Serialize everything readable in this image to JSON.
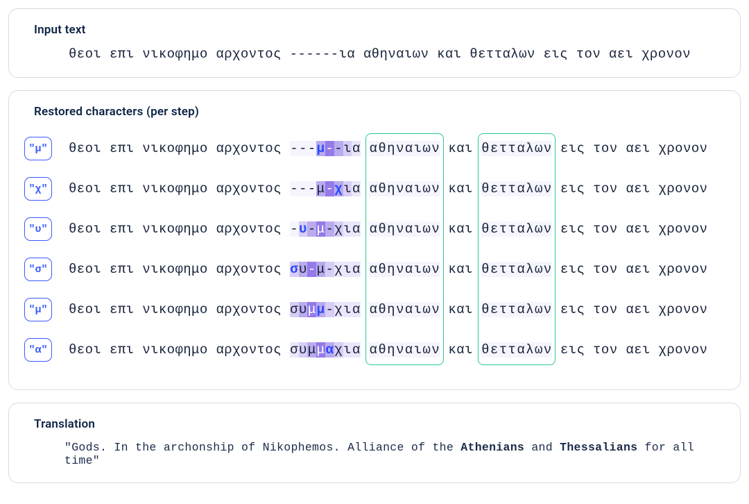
{
  "input_panel": {
    "title": "Input text",
    "text": "θεοι επι νικοφημο αρχοντος ------ια αθηναιων και θετταλων εις τον αει χρονον"
  },
  "steps_panel": {
    "title": "Restored characters (per step)",
    "highlight_words": [
      "αθηναιων",
      "θετταλων"
    ],
    "steps": [
      {
        "badge": "\"μ\"",
        "tokens": [
          "θεοι",
          "επι",
          "νικοφημο",
          "αρχοντος",
          {
            "chars": [
              {
                "c": "-",
                "s": 0
              },
              {
                "c": "-",
                "s": 0
              },
              {
                "c": "-",
                "s": 0
              },
              {
                "c": "μ",
                "s": 3,
                "new": true
              },
              {
                "c": "-",
                "s": 4
              },
              {
                "c": "-",
                "s": 3
              },
              {
                "c": "ι",
                "s": 2
              },
              {
                "c": "α",
                "s": 1
              }
            ]
          },
          "αθηναιων",
          "και",
          "θετταλων",
          "εις",
          "τον",
          "αει",
          "χρονον"
        ]
      },
      {
        "badge": "\"χ\"",
        "tokens": [
          "θεοι",
          "επι",
          "νικοφημο",
          "αρχοντος",
          {
            "chars": [
              {
                "c": "-",
                "s": 0
              },
              {
                "c": "-",
                "s": 0
              },
              {
                "c": "-",
                "s": 0
              },
              {
                "c": "μ",
                "s": 3
              },
              {
                "c": "-",
                "s": 4
              },
              {
                "c": "χ",
                "s": 3,
                "new": true
              },
              {
                "c": "ι",
                "s": 2
              },
              {
                "c": "α",
                "s": 1
              }
            ]
          },
          "αθηναιων",
          "και",
          "θετταλων",
          "εις",
          "τον",
          "αει",
          "χρονον"
        ]
      },
      {
        "badge": "\"υ\"",
        "tokens": [
          "θεοι",
          "επι",
          "νικοφημο",
          "αρχοντος",
          {
            "chars": [
              {
                "c": "-",
                "s": 0
              },
              {
                "c": "υ",
                "s": 2,
                "new": true
              },
              {
                "c": "-",
                "s": 3
              },
              {
                "c": "μ",
                "s": 4
              },
              {
                "c": "-",
                "s": 3
              },
              {
                "c": "χ",
                "s": 2
              },
              {
                "c": "ι",
                "s": 1
              },
              {
                "c": "α",
                "s": 1
              }
            ]
          },
          "αθηναιων",
          "και",
          "θετταλων",
          "εις",
          "τον",
          "αει",
          "χρονον"
        ]
      },
      {
        "badge": "\"σ\"",
        "tokens": [
          "θεοι",
          "επι",
          "νικοφημο",
          "αρχοντος",
          {
            "chars": [
              {
                "c": "σ",
                "s": 2,
                "new": true
              },
              {
                "c": "υ",
                "s": 3
              },
              {
                "c": "-",
                "s": 4
              },
              {
                "c": "μ",
                "s": 3
              },
              {
                "c": "-",
                "s": 2
              },
              {
                "c": "χ",
                "s": 1
              },
              {
                "c": "ι",
                "s": 1
              },
              {
                "c": "α",
                "s": 1
              }
            ]
          },
          "αθηναιων",
          "και",
          "θετταλων",
          "εις",
          "τον",
          "αει",
          "χρονον"
        ]
      },
      {
        "badge": "\"μ\"",
        "tokens": [
          "θεοι",
          "επι",
          "νικοφημο",
          "αρχοντος",
          {
            "chars": [
              {
                "c": "σ",
                "s": 2
              },
              {
                "c": "υ",
                "s": 3
              },
              {
                "c": "μ",
                "s": 4
              },
              {
                "c": "μ",
                "s": 3,
                "new": true
              },
              {
                "c": "-",
                "s": 2
              },
              {
                "c": "χ",
                "s": 1
              },
              {
                "c": "ι",
                "s": 1
              },
              {
                "c": "α",
                "s": 1
              }
            ]
          },
          "αθηναιων",
          "και",
          "θετταλων",
          "εις",
          "τον",
          "αει",
          "χρονον"
        ]
      },
      {
        "badge": "\"α\"",
        "tokens": [
          "θεοι",
          "επι",
          "νικοφημο",
          "αρχοντος",
          {
            "chars": [
              {
                "c": "σ",
                "s": 1
              },
              {
                "c": "υ",
                "s": 2
              },
              {
                "c": "μ",
                "s": 3
              },
              {
                "c": "μ",
                "s": 4
              },
              {
                "c": "α",
                "s": 3,
                "new": true
              },
              {
                "c": "χ",
                "s": 2
              },
              {
                "c": "ι",
                "s": 1
              },
              {
                "c": "α",
                "s": 1
              }
            ]
          },
          "αθηναιων",
          "και",
          "θετταλων",
          "εις",
          "τον",
          "αει",
          "χρονον"
        ]
      }
    ]
  },
  "translation_panel": {
    "title": "Translation",
    "segments": [
      {
        "t": "\"Gods. In the archonship of Nikophemos. Alliance of the ",
        "b": false
      },
      {
        "t": "Athenians",
        "b": true
      },
      {
        "t": " and ",
        "b": false
      },
      {
        "t": "Thessalians",
        "b": true
      },
      {
        "t": " for all time\"",
        "b": false
      }
    ]
  }
}
